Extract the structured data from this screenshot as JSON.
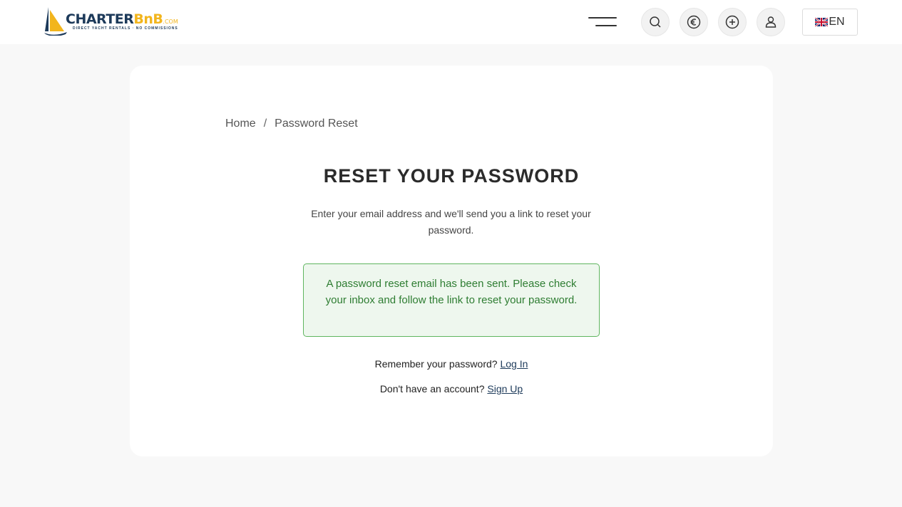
{
  "brand": {
    "name_part1": "CHARTER",
    "name_part2": "BnB",
    "name_suffix": ".COM",
    "tagline": "DIRECT YACHT RENTALS · NO COMMISSIONS"
  },
  "header": {
    "icons": [
      "menu-icon",
      "search-icon",
      "euro-icon",
      "plus-circle-icon",
      "user-icon"
    ],
    "language": "EN"
  },
  "breadcrumb": {
    "home": "Home",
    "separator": "/",
    "current": "Password Reset"
  },
  "page": {
    "title": "RESET YOUR PASSWORD",
    "description": "Enter your email address and we'll send you a link to reset your password.",
    "success_message": "A password reset email has been sent. Please check your inbox and follow the link to reset your password.",
    "remember_text": "Remember your password?",
    "login_link": "Log In",
    "no_account_text": "Don't have an account?",
    "signup_link": "Sign Up"
  },
  "colors": {
    "brand_navy": "#1d3a5a",
    "brand_yellow": "#f2b51d",
    "success_bg": "#eef7ee",
    "success_border": "#5fb55f",
    "success_text": "#2e7d32"
  }
}
